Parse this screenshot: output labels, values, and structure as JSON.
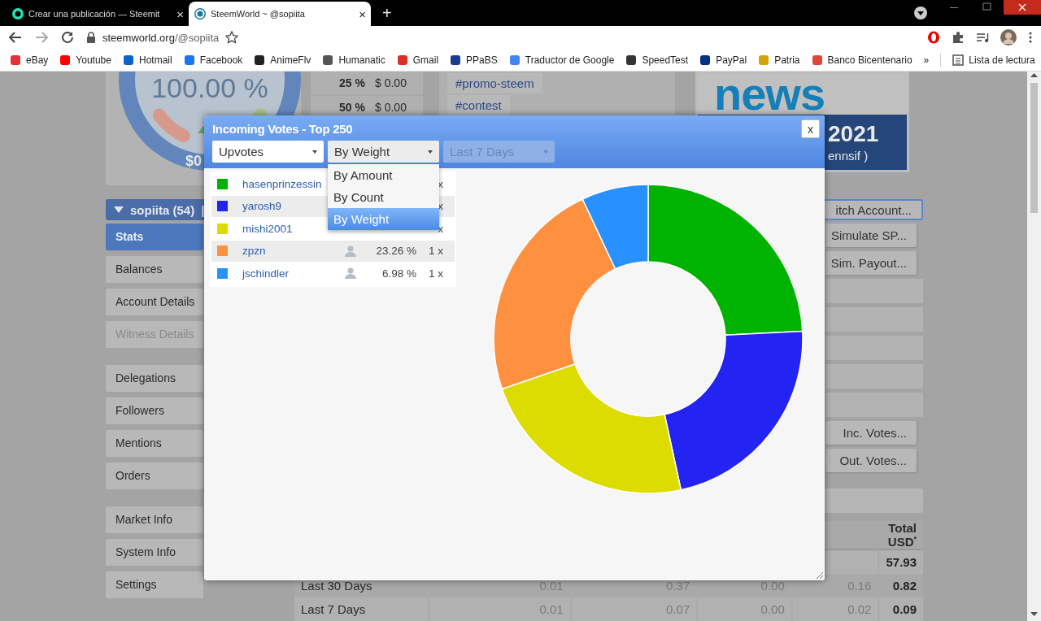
{
  "browser": {
    "tabs": [
      {
        "title": "Crear una publicación — Steemit",
        "close": "×",
        "selected": false
      },
      {
        "title": "SteemWorld ~ @sopiita",
        "close": "×",
        "selected": true
      }
    ],
    "new_tab": "+",
    "address": {
      "domain": "steemworld.org",
      "path": "/@sopiita"
    },
    "bookmarks": [
      {
        "label": "eBay",
        "color": "#e53238"
      },
      {
        "label": "Youtube",
        "color": "#ff0000"
      },
      {
        "label": "Hotmail",
        "color": "#0a64c8"
      },
      {
        "label": "Facebook",
        "color": "#1877f2"
      },
      {
        "label": "AnimeFlv",
        "color": "#222222"
      },
      {
        "label": "Humanatic",
        "color": "#555555"
      },
      {
        "label": "Gmail",
        "color": "#d93025"
      },
      {
        "label": "PPaBS",
        "color": "#1a3c8c"
      },
      {
        "label": "Traductor de Google",
        "color": "#4285f4"
      },
      {
        "label": "SpeedTest",
        "color": "#333333"
      },
      {
        "label": "PayPal",
        "color": "#003087"
      },
      {
        "label": "Patria",
        "color": "#d4a20a"
      },
      {
        "label": "Banco Bicentenario",
        "color": "#e0443a"
      }
    ],
    "more": "»",
    "reading_list": "Lista de lectura"
  },
  "page": {
    "gauge": {
      "reading": "100.00 %",
      "amount": "$0"
    },
    "vote_values": [
      {
        "percent": "25 %",
        "value": "$ 0.00"
      },
      {
        "percent": "50 %",
        "value": "$ 0.00"
      }
    ],
    "tags": [
      "#promo-steem",
      "#contest"
    ],
    "banner": {
      "title": "news",
      "year": "2021",
      "credit": "ennsif )"
    },
    "account": {
      "name": "sopiita (54)",
      "separator": "|",
      "switch_button": "itch Account..."
    },
    "menu_groups": [
      [
        {
          "label": "Stats",
          "selected": true,
          "disabled": false
        },
        {
          "label": "Balances",
          "selected": false,
          "disabled": false
        },
        {
          "label": "Account Details",
          "selected": false,
          "disabled": false
        },
        {
          "label": "Witness Details",
          "selected": false,
          "disabled": true
        }
      ],
      [
        {
          "label": "Delegations",
          "selected": false,
          "disabled": false
        },
        {
          "label": "Followers",
          "selected": false,
          "disabled": false
        },
        {
          "label": "Mentions",
          "selected": false,
          "disabled": false
        },
        {
          "label": "Orders",
          "selected": false,
          "disabled": false
        }
      ],
      [
        {
          "label": "Market Info",
          "selected": false,
          "disabled": false
        },
        {
          "label": "System Info",
          "selected": false,
          "disabled": false
        },
        {
          "label": "Settings",
          "selected": false,
          "disabled": false
        }
      ]
    ],
    "tool_buttons": [
      "Simulate SP...",
      "Sim. Payout..."
    ],
    "vote_buttons": [
      "Inc. Votes...",
      "Out. Votes..."
    ],
    "summary": {
      "total_header": "Total USD$^{*}$",
      "rows": [
        {
          "total": "57.93"
        },
        {
          "label": "Last 30 Days",
          "values": [
            "0.01",
            "0.37",
            "0.00",
            "0.16"
          ],
          "total": "0.82"
        },
        {
          "label": "Last 7 Days",
          "values": [
            "0.01",
            "0.07",
            "0.00",
            "0.02"
          ],
          "total": "0.09"
        }
      ]
    }
  },
  "modal": {
    "title": "Incoming Votes - Top 250",
    "close": "x",
    "selects": [
      {
        "value": "Upvotes",
        "disabled": false,
        "open": false
      },
      {
        "value": "By Weight",
        "disabled": false,
        "open": true,
        "options": [
          {
            "label": "By Amount",
            "selected": false
          },
          {
            "label": "By Count",
            "selected": false
          },
          {
            "label": "By Weight",
            "selected": true
          }
        ]
      },
      {
        "value": "Last 7 Days",
        "disabled": true,
        "open": false
      }
    ],
    "voters": [
      {
        "name": "hasenprinzessin",
        "color": "#00b300",
        "count": "x"
      },
      {
        "name": "yarosh9",
        "color": "#2424f2",
        "count": "x"
      },
      {
        "name": "mishi2001",
        "color": "#dcdc00",
        "count": "x"
      },
      {
        "name": "zpzn",
        "color": "#ff9040",
        "percent": "23.26 %",
        "count": "1 x"
      },
      {
        "name": "jschindler",
        "color": "#2890ff",
        "percent": "6.98 %",
        "count": "1 x"
      }
    ],
    "chart_data": {
      "type": "donut",
      "values": [
        24.2,
        22.4,
        23.16,
        23.26,
        6.98
      ]
    }
  }
}
